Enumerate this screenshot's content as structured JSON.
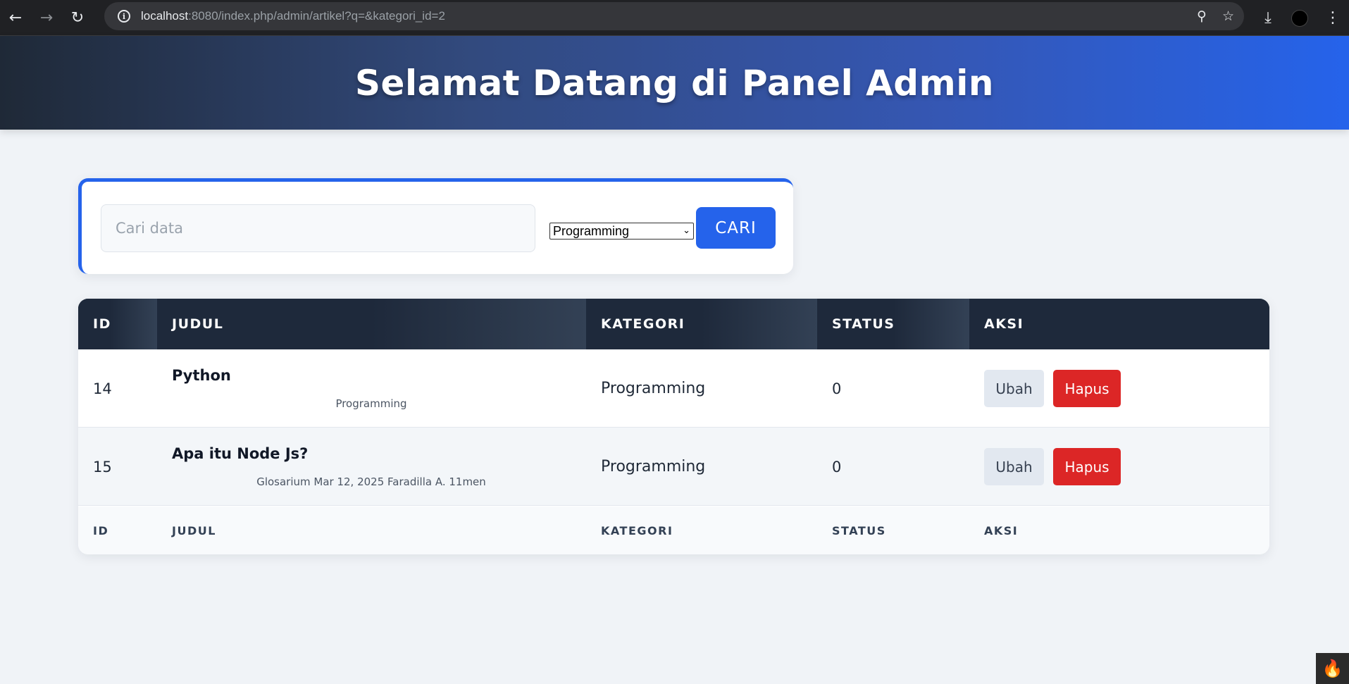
{
  "browser": {
    "url_host": "localhost",
    "url_rest": ":8080/index.php/admin/artikel?q=&kategori_id=2",
    "icons": [
      "back-icon",
      "forward-icon",
      "reload-icon",
      "site-info-icon",
      "zoom-icon",
      "bookmark-star-icon",
      "download-icon",
      "profile-avatar",
      "menu-kebab-icon"
    ]
  },
  "header": {
    "title": "Selamat Datang di Panel Admin"
  },
  "search": {
    "placeholder": "Cari data",
    "value": "",
    "category_selected": "Programming",
    "button_label": "CARI"
  },
  "table": {
    "columns": [
      "ID",
      "JUDUL",
      "KATEGORI",
      "STATUS",
      "AKSI"
    ],
    "rows": [
      {
        "id": "14",
        "judul": "Python",
        "meta": "Programming",
        "kategori": "Programming",
        "status": "0",
        "edit_label": "Ubah",
        "delete_label": "Hapus"
      },
      {
        "id": "15",
        "judul": "Apa itu Node Js?",
        "meta": "Glosarium Mar 12, 2025 Faradilla A. 11men",
        "kategori": "Programming",
        "status": "0",
        "edit_label": "Ubah",
        "delete_label": "Hapus"
      }
    ],
    "footer": [
      "ID",
      "JUDUL",
      "KATEGORI",
      "STATUS",
      "AKSI"
    ]
  },
  "colors": {
    "accent": "#2563eb",
    "header_dark": "#1e293b",
    "danger": "#dc2626",
    "neutral_button": "#e2e8f0"
  }
}
